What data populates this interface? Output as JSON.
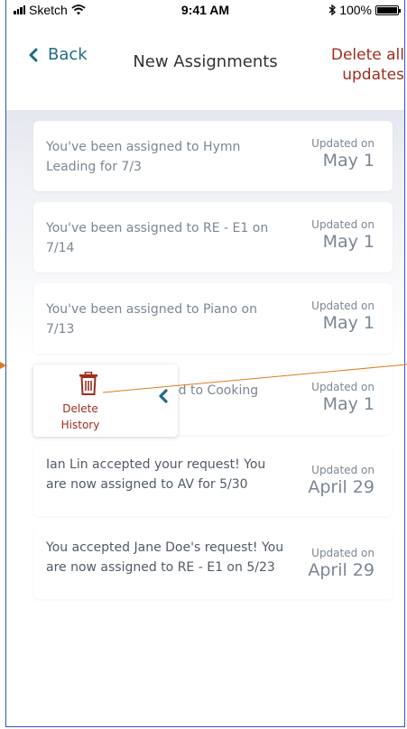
{
  "status_bar": {
    "carrier": "Sketch",
    "time": "9:41 AM",
    "battery": "100%"
  },
  "nav": {
    "back_label": "Back",
    "title": "New Assignments",
    "action_line1": "Delete all",
    "action_line2": "updates"
  },
  "assignments": [
    {
      "text": "You've been assigned to Hymn Leading for 7/3",
      "updated_label": "Updated on",
      "date": "May 1"
    },
    {
      "text": "You've been assigned to RE - E1 on 7/14",
      "updated_label": "Updated on",
      "date": "May 1"
    },
    {
      "text": "You've been assigned to Piano on 7/13",
      "updated_label": "Updated on",
      "date": "May 1"
    },
    {
      "text": "ed to Cooking",
      "updated_label": "Updated on",
      "date": "May 1"
    },
    {
      "text": "Ian Lin accepted your request! You are now assigned to AV for 5/30",
      "updated_label": "Updated on",
      "date": "April 29"
    },
    {
      "text": "You accepted Jane Doe's request! You are now assigned to RE - E1 on 5/23",
      "updated_label": "Updated on",
      "date": "April 29"
    }
  ],
  "swipe_action": {
    "line1": "Delete",
    "line2": "History"
  },
  "colors": {
    "accent": "#1e6d85",
    "destructive": "#a02d1e",
    "annotation": "#e07b20",
    "frame": "#2d56c8"
  },
  "icons": {
    "back": "chevron-left-icon",
    "delete": "trash-icon",
    "swipe": "chevron-left-icon",
    "wifi": "wifi-icon",
    "bluetooth": "bluetooth-icon"
  }
}
